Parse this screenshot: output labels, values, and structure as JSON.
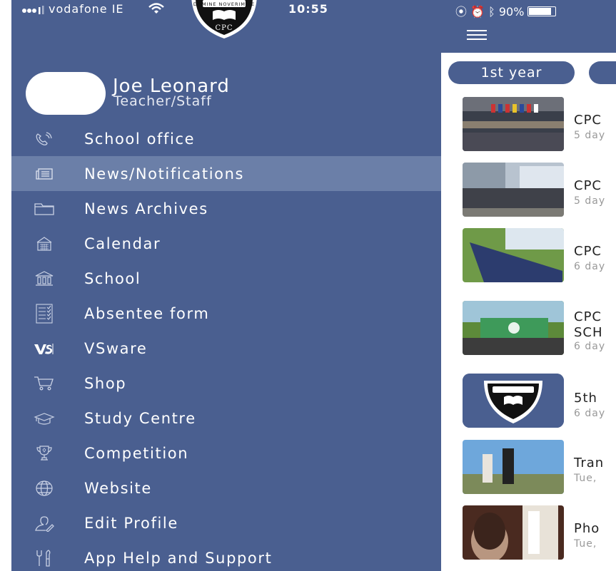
{
  "status_left": {
    "carrier": "vodafone IE",
    "time": "10:55"
  },
  "status_right": {
    "battery": "90%"
  },
  "profile": {
    "name": "Joe Leonard",
    "role": "Teacher/Staff"
  },
  "crest": {
    "motto": "DOMINE NOVERIM TE",
    "monogram": "CPC"
  },
  "menu": [
    {
      "label": "School office",
      "icon": "phone-icon"
    },
    {
      "label": "News/Notifications",
      "icon": "news-icon",
      "active": true
    },
    {
      "label": "News Archives",
      "icon": "folder-icon"
    },
    {
      "label": "Calendar",
      "icon": "calendar-icon"
    },
    {
      "label": "School",
      "icon": "school-icon"
    },
    {
      "label": "Absentee form",
      "icon": "checklist-icon"
    },
    {
      "label": "VSware",
      "icon": "vsware-icon"
    },
    {
      "label": "Shop",
      "icon": "cart-icon"
    },
    {
      "label": "Study Centre",
      "icon": "graduation-cap-icon"
    },
    {
      "label": "Competition",
      "icon": "trophy-icon"
    },
    {
      "label": "Website",
      "icon": "globe-icon"
    },
    {
      "label": "Edit Profile",
      "icon": "user-icon"
    },
    {
      "label": "App Help and Support",
      "icon": "tools-icon"
    }
  ],
  "filters": [
    {
      "label": "1st year"
    },
    {
      "label": ""
    }
  ],
  "news": [
    {
      "title": "CPC",
      "subtitle": "5 day"
    },
    {
      "title": "CPC",
      "subtitle": "5 day"
    },
    {
      "title": "CPC",
      "subtitle": "6 day"
    },
    {
      "title": "CPC",
      "title2": "SCH",
      "subtitle": "6 day"
    },
    {
      "title": "5th",
      "subtitle": "6 day"
    },
    {
      "title": "Tran",
      "subtitle": "Tue,"
    },
    {
      "title": "Pho",
      "subtitle": "Tue,"
    }
  ],
  "colors": {
    "drawer": "#4a5f90",
    "active": "#6b7fa8"
  }
}
